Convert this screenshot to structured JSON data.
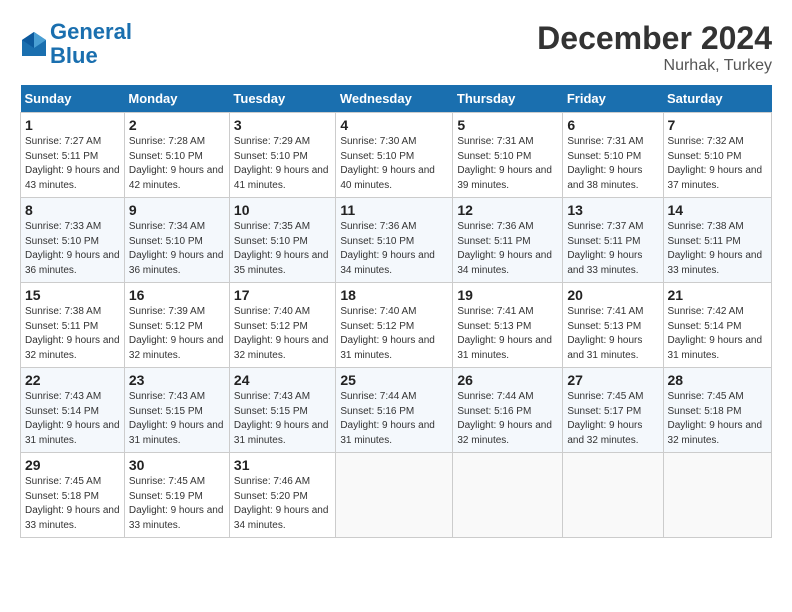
{
  "header": {
    "logo_line1": "General",
    "logo_line2": "Blue",
    "month_year": "December 2024",
    "location": "Nurhak, Turkey"
  },
  "weekdays": [
    "Sunday",
    "Monday",
    "Tuesday",
    "Wednesday",
    "Thursday",
    "Friday",
    "Saturday"
  ],
  "weeks": [
    [
      {
        "day": 1,
        "sunrise": "7:27 AM",
        "sunset": "5:11 PM",
        "daylight": "9 hours and 43 minutes."
      },
      {
        "day": 2,
        "sunrise": "7:28 AM",
        "sunset": "5:10 PM",
        "daylight": "9 hours and 42 minutes."
      },
      {
        "day": 3,
        "sunrise": "7:29 AM",
        "sunset": "5:10 PM",
        "daylight": "9 hours and 41 minutes."
      },
      {
        "day": 4,
        "sunrise": "7:30 AM",
        "sunset": "5:10 PM",
        "daylight": "9 hours and 40 minutes."
      },
      {
        "day": 5,
        "sunrise": "7:31 AM",
        "sunset": "5:10 PM",
        "daylight": "9 hours and 39 minutes."
      },
      {
        "day": 6,
        "sunrise": "7:31 AM",
        "sunset": "5:10 PM",
        "daylight": "9 hours and 38 minutes."
      },
      {
        "day": 7,
        "sunrise": "7:32 AM",
        "sunset": "5:10 PM",
        "daylight": "9 hours and 37 minutes."
      }
    ],
    [
      {
        "day": 8,
        "sunrise": "7:33 AM",
        "sunset": "5:10 PM",
        "daylight": "9 hours and 36 minutes."
      },
      {
        "day": 9,
        "sunrise": "7:34 AM",
        "sunset": "5:10 PM",
        "daylight": "9 hours and 36 minutes."
      },
      {
        "day": 10,
        "sunrise": "7:35 AM",
        "sunset": "5:10 PM",
        "daylight": "9 hours and 35 minutes."
      },
      {
        "day": 11,
        "sunrise": "7:36 AM",
        "sunset": "5:10 PM",
        "daylight": "9 hours and 34 minutes."
      },
      {
        "day": 12,
        "sunrise": "7:36 AM",
        "sunset": "5:11 PM",
        "daylight": "9 hours and 34 minutes."
      },
      {
        "day": 13,
        "sunrise": "7:37 AM",
        "sunset": "5:11 PM",
        "daylight": "9 hours and 33 minutes."
      },
      {
        "day": 14,
        "sunrise": "7:38 AM",
        "sunset": "5:11 PM",
        "daylight": "9 hours and 33 minutes."
      }
    ],
    [
      {
        "day": 15,
        "sunrise": "7:38 AM",
        "sunset": "5:11 PM",
        "daylight": "9 hours and 32 minutes."
      },
      {
        "day": 16,
        "sunrise": "7:39 AM",
        "sunset": "5:12 PM",
        "daylight": "9 hours and 32 minutes."
      },
      {
        "day": 17,
        "sunrise": "7:40 AM",
        "sunset": "5:12 PM",
        "daylight": "9 hours and 32 minutes."
      },
      {
        "day": 18,
        "sunrise": "7:40 AM",
        "sunset": "5:12 PM",
        "daylight": "9 hours and 31 minutes."
      },
      {
        "day": 19,
        "sunrise": "7:41 AM",
        "sunset": "5:13 PM",
        "daylight": "9 hours and 31 minutes."
      },
      {
        "day": 20,
        "sunrise": "7:41 AM",
        "sunset": "5:13 PM",
        "daylight": "9 hours and 31 minutes."
      },
      {
        "day": 21,
        "sunrise": "7:42 AM",
        "sunset": "5:14 PM",
        "daylight": "9 hours and 31 minutes."
      }
    ],
    [
      {
        "day": 22,
        "sunrise": "7:43 AM",
        "sunset": "5:14 PM",
        "daylight": "9 hours and 31 minutes."
      },
      {
        "day": 23,
        "sunrise": "7:43 AM",
        "sunset": "5:15 PM",
        "daylight": "9 hours and 31 minutes."
      },
      {
        "day": 24,
        "sunrise": "7:43 AM",
        "sunset": "5:15 PM",
        "daylight": "9 hours and 31 minutes."
      },
      {
        "day": 25,
        "sunrise": "7:44 AM",
        "sunset": "5:16 PM",
        "daylight": "9 hours and 31 minutes."
      },
      {
        "day": 26,
        "sunrise": "7:44 AM",
        "sunset": "5:16 PM",
        "daylight": "9 hours and 32 minutes."
      },
      {
        "day": 27,
        "sunrise": "7:45 AM",
        "sunset": "5:17 PM",
        "daylight": "9 hours and 32 minutes."
      },
      {
        "day": 28,
        "sunrise": "7:45 AM",
        "sunset": "5:18 PM",
        "daylight": "9 hours and 32 minutes."
      }
    ],
    [
      {
        "day": 29,
        "sunrise": "7:45 AM",
        "sunset": "5:18 PM",
        "daylight": "9 hours and 33 minutes."
      },
      {
        "day": 30,
        "sunrise": "7:45 AM",
        "sunset": "5:19 PM",
        "daylight": "9 hours and 33 minutes."
      },
      {
        "day": 31,
        "sunrise": "7:46 AM",
        "sunset": "5:20 PM",
        "daylight": "9 hours and 34 minutes."
      },
      null,
      null,
      null,
      null
    ]
  ]
}
